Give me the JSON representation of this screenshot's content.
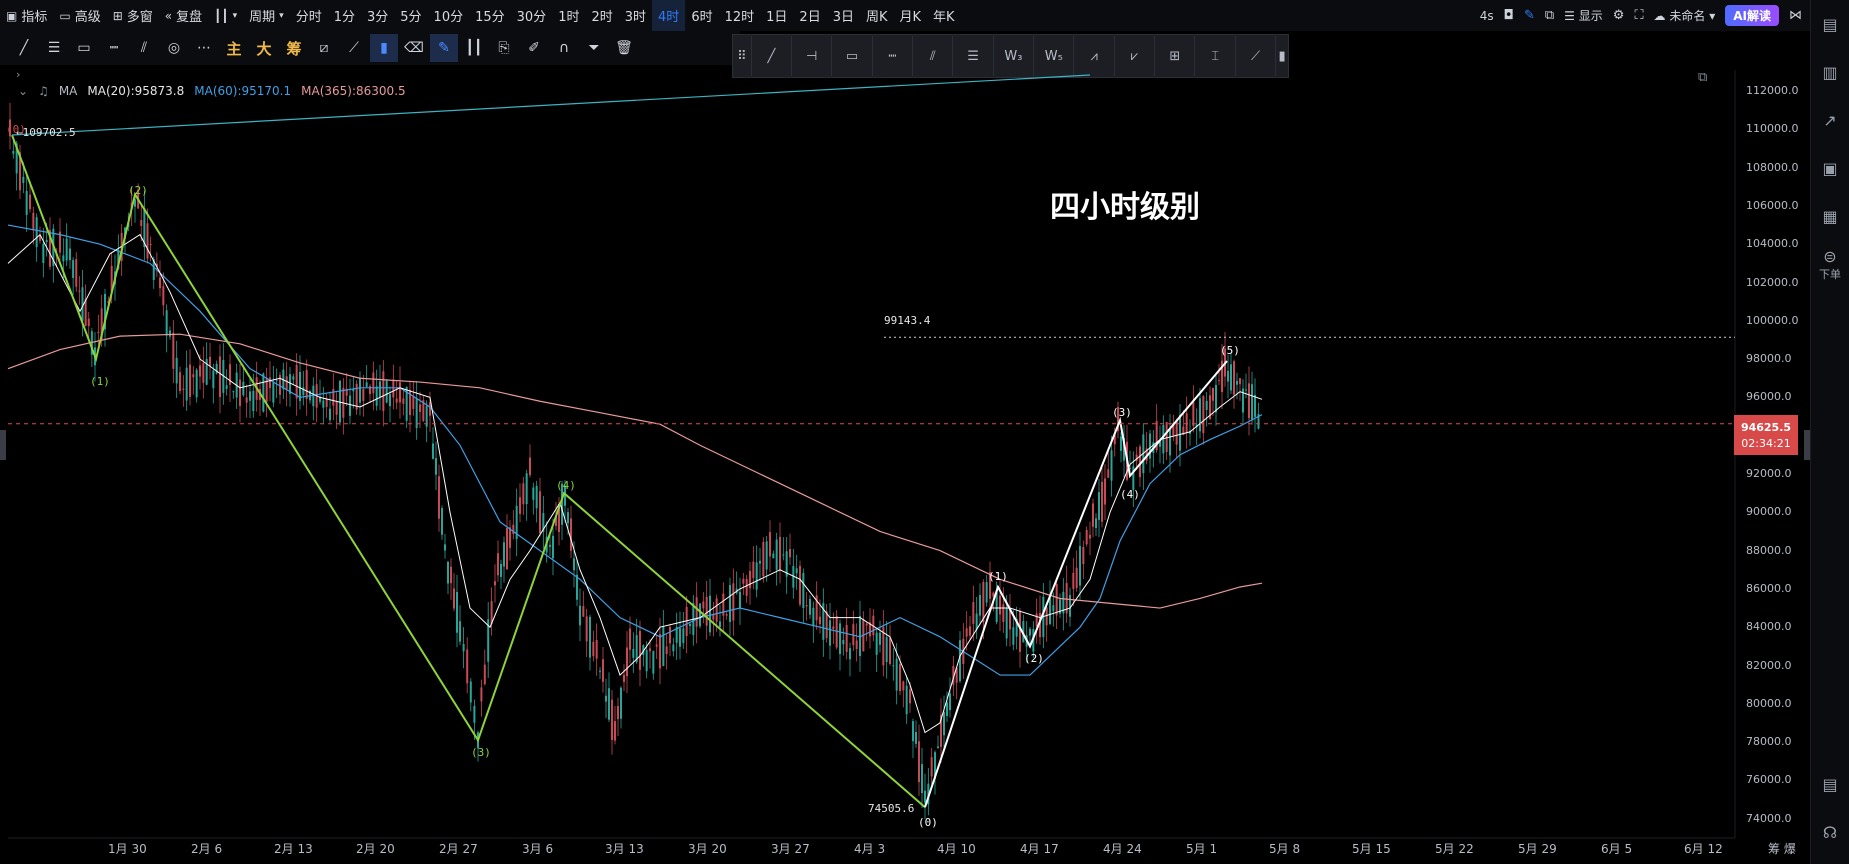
{
  "toolbar": {
    "indicator": "指标",
    "advanced": "高级",
    "multi_window": "多窗",
    "replay": "复盘",
    "period": "周期",
    "periods": [
      "分时",
      "1分",
      "3分",
      "5分",
      "10分",
      "15分",
      "30分",
      "1时",
      "2时",
      "3时",
      "4时",
      "6时",
      "12时",
      "1日",
      "2日",
      "3日",
      "周K",
      "月K",
      "年K"
    ],
    "active_period": "4时",
    "refresh": "4s",
    "display": "显示",
    "unnamed": "未命名",
    "ai": "AI解读"
  },
  "draw_tools": {
    "cn1": "主",
    "cn2": "大",
    "cn3": "筹"
  },
  "legend": {
    "ma_label": "MA",
    "ma20": "MA(20):95873.8",
    "ma60": "MA(60):95170.1",
    "ma365": "MA(365):86300.5",
    "colors": {
      "ma20": "#ffffff",
      "ma60": "#3fa0e6",
      "ma365": "#e79a9a"
    }
  },
  "chart_title": "四小时级别",
  "price_axis": [
    "112000.0",
    "110000.0",
    "108000.0",
    "106000.0",
    "104000.0",
    "102000.0",
    "100000.0",
    "98000.0",
    "96000.0",
    "94000.0",
    "92000.0",
    "90000.0",
    "88000.0",
    "86000.0",
    "84000.0",
    "82000.0",
    "80000.0",
    "78000.0",
    "76000.0",
    "74000.0"
  ],
  "current_price": "94625.5",
  "countdown": "02:34:21",
  "dates": [
    "1月 30",
    "2月 6",
    "2月 13",
    "2月 20",
    "2月 27",
    "3月 6",
    "3月 13",
    "3月 20",
    "3月 27",
    "4月 3",
    "4月 10",
    "4月 17",
    "4月 24",
    "5月 1",
    "5月 8",
    "5月 15",
    "5月 22",
    "5月 29",
    "6月 5",
    "6月 12"
  ],
  "corner": {
    "a": "筹",
    "b": "爆"
  },
  "annotations": {
    "high": "109702.5",
    "low": "74505.6",
    "level": "99143.4"
  },
  "waves": {
    "green": [
      "(0)",
      "(1)",
      "(2)",
      "(3)",
      "(4)"
    ],
    "white": [
      "(0)",
      "(1)",
      "(2)",
      "(3)",
      "(4)",
      "(5)"
    ]
  },
  "right_panel": {
    "download": "下单"
  }
}
